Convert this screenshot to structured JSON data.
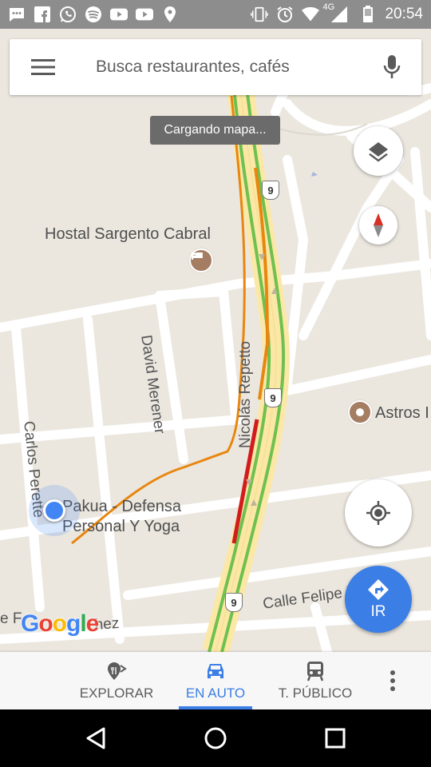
{
  "status_bar": {
    "time": "20:54",
    "network": "4G",
    "left_icons": [
      "messages-icon",
      "facebook-icon",
      "whatsapp-icon",
      "spotify-icon",
      "youtube-icon",
      "youtube-icon",
      "location-icon"
    ],
    "right_icons": [
      "vibrate-icon",
      "alarm-icon",
      "wifi-icon",
      "signal-icon",
      "battery-icon"
    ]
  },
  "search": {
    "placeholder": "Busca restaurantes, cafés"
  },
  "toast": {
    "text": "Cargando mapa..."
  },
  "map": {
    "places": [
      {
        "label": "Hostal Sargento Cabral",
        "icon": "hotel-icon"
      },
      {
        "label": "Astros I",
        "icon": "poi-icon"
      },
      {
        "label": "Pakua - Defensa\nPersonal Y Yoga"
      }
    ],
    "streets": [
      "David Merener",
      "Nicolás Repetto",
      "Carlos Perette",
      "Calle Felipe Bouchez",
      "hez",
      "e F"
    ],
    "route_number": "9",
    "logo": "Google"
  },
  "go_button": {
    "label": "IR"
  },
  "tabs": [
    {
      "label": "EXPLORAR",
      "icon": "explore-pin-icon",
      "active": false
    },
    {
      "label": "EN AUTO",
      "icon": "car-icon",
      "active": true
    },
    {
      "label": "T. PÚBLICO",
      "icon": "train-icon",
      "active": false
    }
  ],
  "colors": {
    "accent": "#3b7ee6",
    "traffic_green": "#6fc04f",
    "traffic_orange": "#e8860f",
    "traffic_red": "#d21c1c",
    "highway": "#fbe8a6",
    "map_bg": "#ebe7df",
    "poi": "#a57d63"
  }
}
